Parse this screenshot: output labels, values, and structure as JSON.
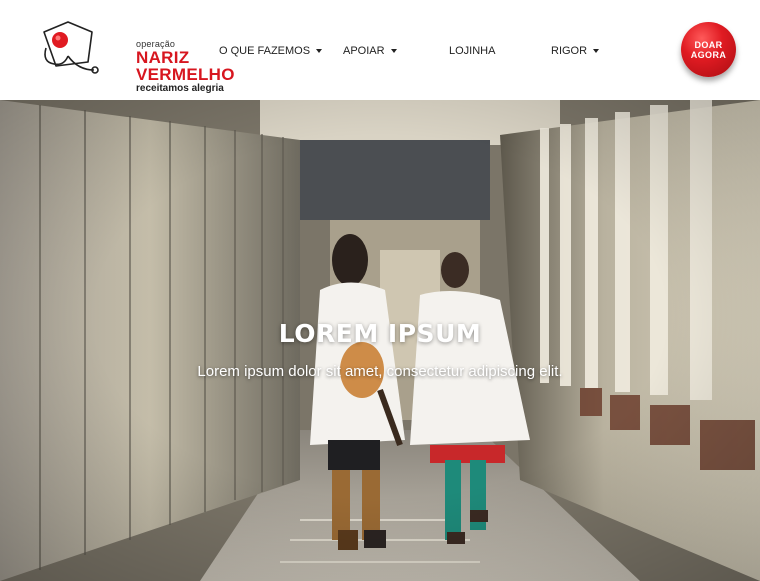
{
  "logo": {
    "pre": "operação",
    "line1": "NARIZ",
    "line2": "VERMELHO",
    "tagline": "receitamos alegria"
  },
  "nav": {
    "items": [
      {
        "label": "O QUE FAZEMOS",
        "dropdown": true
      },
      {
        "label": "APOIAR",
        "dropdown": true
      },
      {
        "label": "LOJINHA",
        "dropdown": false
      },
      {
        "label": "RIGOR",
        "dropdown": true
      }
    ]
  },
  "donate": {
    "line1": "DOAR",
    "line2": "AGORA"
  },
  "hero": {
    "title": "LOREM IPSUM",
    "subtitle": "Lorem ipsum dolor sit amet, consectetur adipiscing elit."
  },
  "colors": {
    "brand_red": "#d7161f",
    "text_dark": "#222222",
    "white": "#ffffff"
  },
  "icons": {
    "dropdown": "caret-down-icon",
    "logo": "red-nose-stethoscope-logo"
  }
}
